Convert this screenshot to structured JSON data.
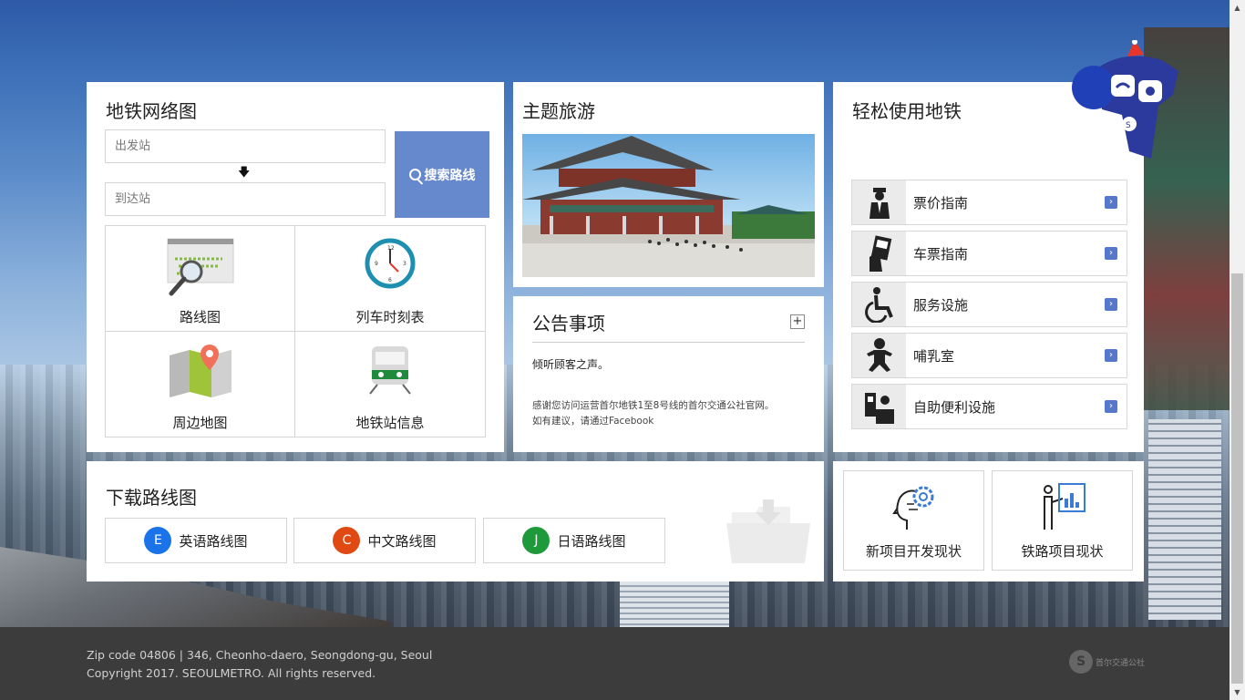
{
  "subway_map": {
    "title": "地铁网络图",
    "from_placeholder": "出发站",
    "to_placeholder": "到达站",
    "search_label": "搜索路线",
    "grid": [
      {
        "label": "路线图",
        "icon": "route-map-search-icon"
      },
      {
        "label": "列车时刻表",
        "icon": "clock-icon"
      },
      {
        "label": "周边地图",
        "icon": "map-pin-icon"
      },
      {
        "label": "地铁站信息",
        "icon": "train-icon"
      }
    ]
  },
  "theme_travel": {
    "title": "主题旅游",
    "photo": "palace-photo"
  },
  "notices": {
    "title": "公告事项",
    "more_label": "+",
    "item1": "倾听顾客之声。",
    "body_line1": "感谢您访问运营首尔地铁1至8号线的首尔交通公社官网。",
    "body_line2": "如有建议，请通过Facebook"
  },
  "easy_use": {
    "title": "轻松使用地铁",
    "items": [
      {
        "label": "票价指南",
        "icon": "staff-icon"
      },
      {
        "label": "车票指南",
        "icon": "ticket-icon"
      },
      {
        "label": "服务设施",
        "icon": "wheelchair-icon"
      },
      {
        "label": "哺乳室",
        "icon": "baby-icon"
      },
      {
        "label": "自助便利设施",
        "icon": "kiosk-icon"
      }
    ]
  },
  "download": {
    "title": "下载路线图",
    "buttons": [
      {
        "badge": "E",
        "label": "英语路线图",
        "color": "#1a73e8"
      },
      {
        "badge": "C",
        "label": "中文路线图",
        "color": "#e04a12"
      },
      {
        "badge": "J",
        "label": "日语路线图",
        "color": "#1e9a3a"
      }
    ]
  },
  "projects": {
    "new": "新项目开发现状",
    "rail": "铁路项目现状"
  },
  "footer": {
    "address": "Zip code 04806 | 346, Cheonho-daero, Seongdong-gu, Seoul",
    "copyright": "Copyright 2017. SEOULMETRO. All rights reserved.",
    "logo_text": "首尔交通公社"
  },
  "colors": {
    "accent": "#6688cc",
    "footer_bg": "#3c3c3c"
  }
}
